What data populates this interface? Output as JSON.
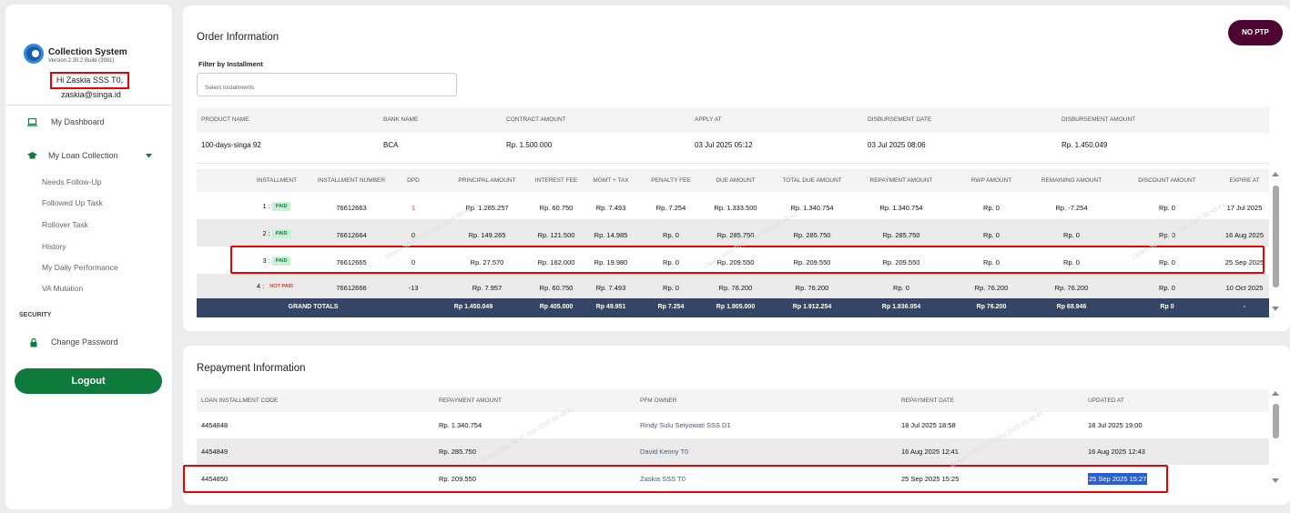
{
  "sidebar": {
    "app_title": "Collection System",
    "version": "Version 2.35.2 Build (3981)",
    "greeting": "Hi Zaskia SSS T0,",
    "email": "zaskia@singa.id",
    "nav": {
      "dashboard": "My Dashboard",
      "loan_collection": "My Loan Collection"
    },
    "sub_items": [
      "Needs Follow-Up",
      "Followed Up Task",
      "Rollover Task",
      "History",
      "My Daily Performance",
      "VA Mutation"
    ],
    "security_heading": "SECURITY",
    "change_password": "Change Password",
    "logout": "Logout"
  },
  "order": {
    "title": "Order Information",
    "no_ptp": "NO PTP",
    "filter_label": "Filter by Installment",
    "filter_placeholder": "Select Installments",
    "product_headers": [
      "PRODUCT NAME",
      "BANK NAME",
      "CONTRACT AMOUNT",
      "APPLY AT",
      "DISBURSEMENT DATE",
      "DISBURSEMENT AMOUNT"
    ],
    "product_row": [
      "100-days-singa 92",
      "BCA",
      "Rp. 1.500.000",
      "03 Jul 2025 05:12",
      "03 Jul 2025 08:06",
      "Rp. 1.450.049"
    ],
    "inst_headers": [
      "INSTALLMENT",
      "INSTALLMENT NUMBER",
      "DPD",
      "PRINCIPAL AMOUNT",
      "INTEREST FEE",
      "MGMT + TAX",
      "PENALTY FEE",
      "DUE AMOUNT",
      "TOTAL DUE AMOUNT",
      "REPAYMENT AMOUNT",
      "RWP AMOUNT",
      "REMAINING AMOUNT",
      "DISCOUNT AMOUNT",
      "EXPIRE AT"
    ],
    "inst_rows": [
      {
        "no": "1 :",
        "badge": "PAID",
        "cells": [
          "76612663",
          "1",
          "Rp. 1.265.257",
          "Rp. 60.750",
          "Rp. 7.493",
          "Rp. 7.254",
          "Rp. 1.333.500",
          "Rp. 1.340.754",
          "Rp. 1.340.754",
          "Rp. 0",
          "Rp. -7.254",
          "Rp. 0",
          "17 Jul 2025"
        ]
      },
      {
        "no": "2 :",
        "badge": "PAID",
        "cells": [
          "76612664",
          "0",
          "Rp. 149.265",
          "Rp. 121.500",
          "Rp. 14.985",
          "Rp. 0",
          "Rp. 285.750",
          "Rp. 285.750",
          "Rp. 285.750",
          "Rp. 0",
          "Rp. 0",
          "Rp. 0",
          "16 Aug 2025"
        ]
      },
      {
        "no": "3 :",
        "badge": "PAID",
        "cells": [
          "76612665",
          "0",
          "Rp. 27.570",
          "Rp. 162.000",
          "Rp. 19.980",
          "Rp. 0",
          "Rp. 209.550",
          "Rp. 209.550",
          "Rp. 209.550",
          "Rp. 0",
          "Rp. 0",
          "Rp. 0",
          "25 Sep 2025"
        ]
      },
      {
        "no": "4 :",
        "badge": "NOT PAID",
        "cells": [
          "76612666",
          "-13",
          "Rp. 7.957",
          "Rp. 60.750",
          "Rp. 7.493",
          "Rp. 0",
          "Rp. 76.200",
          "Rp. 76.200",
          "Rp. 0",
          "Rp. 76.200",
          "Rp. 76.200",
          "Rp. 0",
          "10 Oct 2025"
        ]
      }
    ],
    "grand_totals": {
      "label": "GRAND TOTALS",
      "cells": [
        "Rp 1.450.049",
        "Rp 405.000",
        "Rp 49.951",
        "Rp 7.254",
        "Rp 1.905.000",
        "Rp 1.912.254",
        "Rp 1.836.054",
        "Rp 76.200",
        "Rp 68.946",
        "Rp 0",
        "-"
      ]
    }
  },
  "repayment": {
    "title": "Repayment Information",
    "headers": [
      "LOAN INSTALLMENT CODE",
      "REPAYMENT AMOUNT",
      "PFM OWNER",
      "REPAYMENT DATE",
      "UPDATED AT"
    ],
    "rows": [
      [
        "4454848",
        "Rp. 1.340.754",
        "Rindy Sulu Setyowati SSS D1",
        "18 Jul 2025 18:58",
        "18 Jul 2025 19:00"
      ],
      [
        "4454849",
        "Rp. 285.750",
        "David Kenny T0",
        "16 Aug 2025 12:41",
        "16 Aug 2025 12:43"
      ],
      [
        "4454850",
        "Rp. 209.550",
        "Zaskia SSS T0",
        "25 Sep 2025 15:25",
        "25 Sep 2025 15:27"
      ]
    ]
  },
  "watermark": "Zaskia SSS T0 27 Sep 2025 08:48:41",
  "colors": {
    "brand_green": "#0e7a3b",
    "no_ptp": "#4e0531",
    "totals_row": "#344565",
    "highlight": "#e00000",
    "paid_badge": "#c9f1d7"
  }
}
